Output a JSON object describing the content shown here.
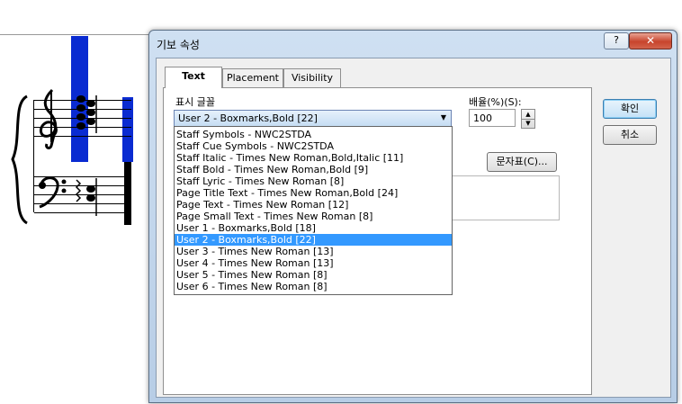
{
  "dialog": {
    "title": "기보 속성",
    "help_label": "?",
    "close_label": "✕"
  },
  "tabs": [
    {
      "label": "Text",
      "active": true
    },
    {
      "label": "Placement",
      "active": false
    },
    {
      "label": "Visibility",
      "active": false
    }
  ],
  "font_section": {
    "label": "표시 글꼴",
    "selected": "User 2 - Boxmarks,Bold [22]",
    "options": [
      "Staff Symbols - NWC2STDA",
      "Staff Cue Symbols - NWC2STDA",
      "Staff Italic - Times New Roman,Bold,Italic [11]",
      "Staff Bold - Times New Roman,Bold [9]",
      "Staff Lyric - Times New Roman [8]",
      "Page Title Text - Times New Roman,Bold [24]",
      "Page Text - Times New Roman [12]",
      "Page Small Text - Times New Roman [8]",
      "User 1 - Boxmarks,Bold [18]",
      "User 2 - Boxmarks,Bold [22]",
      "User 3 - Times New Roman [13]",
      "User 4 - Times New Roman [13]",
      "User 5 - Times New Roman [8]",
      "User 6 - Times New Roman [8]"
    ],
    "selected_index": 9
  },
  "scale": {
    "label": "배율(%)(S):",
    "value": "100"
  },
  "charmap_button": "문자표(C)...",
  "ok_button": "확인",
  "cancel_button": "취소",
  "colors": {
    "accent_blue": "#3399ff",
    "score_highlight": "#0a2bd1"
  }
}
